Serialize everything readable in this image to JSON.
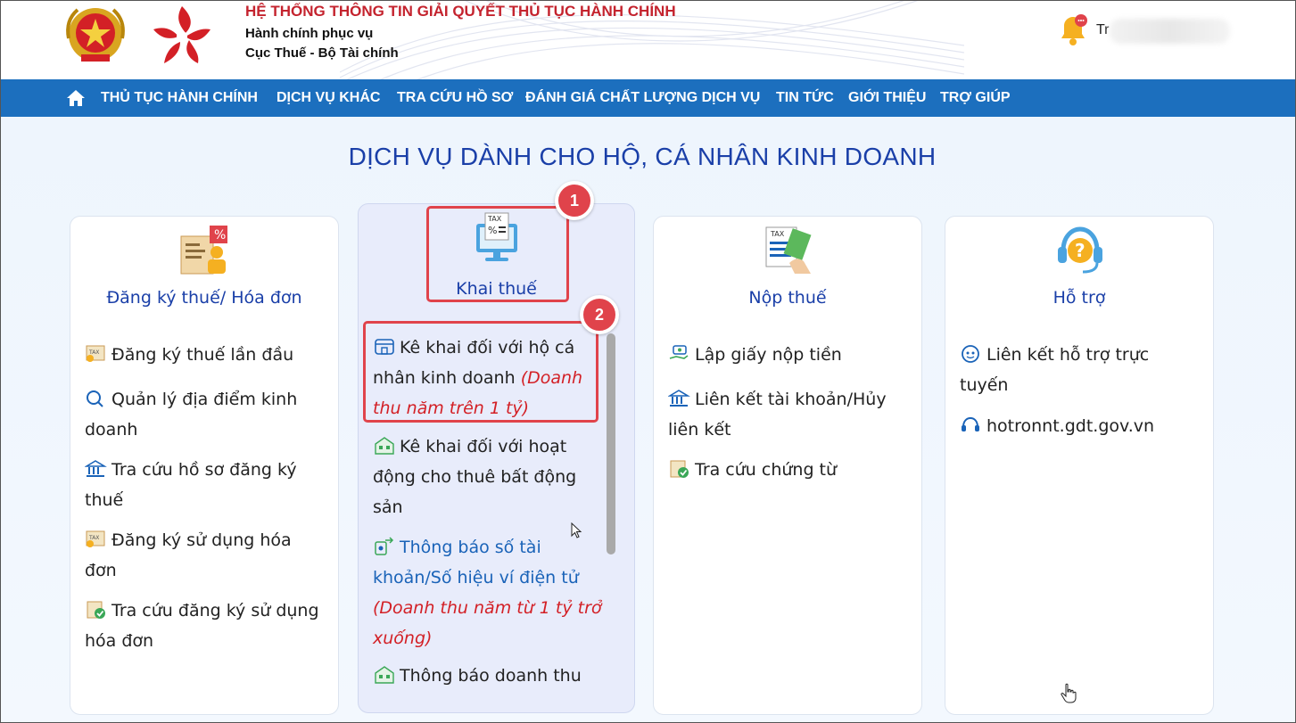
{
  "header": {
    "system_title": "HỆ THỐNG THÔNG TIN GIẢI QUYẾT THỦ TỤC HÀNH CHÍNH",
    "subtitle1": "Hành chính phục vụ",
    "subtitle2": "Cục Thuế - Bộ Tài chính",
    "user_name_visible": "Tr"
  },
  "nav": {
    "items": [
      {
        "label": "THỦ TỤC HÀNH CHÍNH"
      },
      {
        "label": "DỊCH VỤ KHÁC"
      },
      {
        "label": "TRA CỨU HỒ SƠ"
      },
      {
        "label": "ĐÁNH GIÁ CHẤT LƯỢNG DỊCH VỤ"
      },
      {
        "label": "TIN TỨC"
      },
      {
        "label": "GIỚI THIỆU"
      },
      {
        "label": "TRỢ GIÚP"
      }
    ]
  },
  "main": {
    "title": "DỊCH VỤ DÀNH CHO HỘ, CÁ NHÂN KINH DOANH",
    "cards": [
      {
        "title": "Đăng ký thuế/ Hóa đơn",
        "icon": "tax-registration-icon",
        "items": [
          {
            "text": "Đăng ký thuế lần đầu"
          },
          {
            "text": "Quản lý địa điểm kinh doanh"
          },
          {
            "text": "Tra cứu hồ sơ đăng ký thuế"
          },
          {
            "text": "Đăng ký sử dụng hóa đơn"
          },
          {
            "text": "Tra cứu đăng ký sử dụng hóa đơn"
          }
        ]
      },
      {
        "title": "Khai thuế",
        "icon": "tax-computer-icon",
        "items": [
          {
            "text": "Kê khai đối với hộ cá nhân kinh doanh",
            "note": "(Doanh thu năm trên 1 tỷ)"
          },
          {
            "text": "Kê khai đối với hoạt động cho thuê bất động sản"
          },
          {
            "text": "Thông báo số tài khoản/Số hiệu ví điện tử",
            "note": "(Doanh thu năm từ 1 tỷ trở xuống)"
          },
          {
            "text": "Thông báo doanh thu"
          }
        ]
      },
      {
        "title": "Nộp thuế",
        "icon": "tax-payment-icon",
        "items": [
          {
            "text": "Lập giấy nộp tiền"
          },
          {
            "text": "Liên kết tài khoản/Hủy liên kết"
          },
          {
            "text": "Tra cứu chứng từ"
          }
        ]
      },
      {
        "title": "Hỗ trợ",
        "icon": "support-headset-icon",
        "items": [
          {
            "text": "Liên kết hỗ trợ trực tuyến"
          },
          {
            "text": "hotronnt.gdt.gov.vn"
          }
        ]
      }
    ]
  },
  "annotations": {
    "step1": "1",
    "step2": "2",
    "highlight_color": "#e0434b"
  },
  "colors": {
    "nav_bg": "#1c6fbe",
    "title_blue": "#1a3fa8",
    "brand_red": "#c4232e"
  }
}
